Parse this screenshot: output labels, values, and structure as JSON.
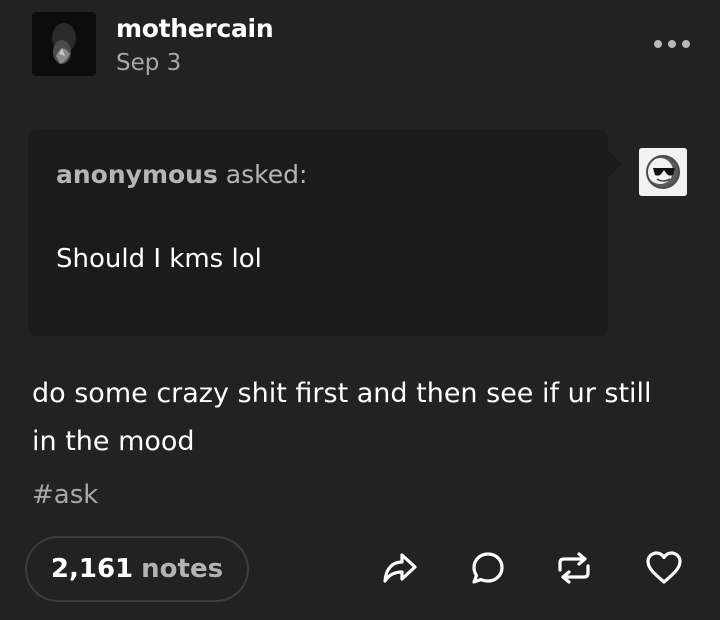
{
  "post": {
    "blog_name": "mothercain",
    "date": "Sep 3",
    "more_icon": "meatball-menu-icon"
  },
  "ask": {
    "asker": "anonymous",
    "asked_label": "asked:",
    "question": "Should I kms lol",
    "asker_avatar_icon": "sunglasses-face-avatar"
  },
  "answer": {
    "text": "do some crazy shit first and then see if ur still in the mood"
  },
  "tags": [
    "#ask"
  ],
  "footer": {
    "notes_count": "2,161",
    "notes_label": "notes",
    "actions": [
      "share-icon",
      "reply-icon",
      "reblog-icon",
      "like-icon"
    ]
  },
  "colors": {
    "background": "#222222",
    "ask_box": "#1b1b1b",
    "muted_text": "#a8a8a8",
    "primary_text": "#ffffff"
  }
}
